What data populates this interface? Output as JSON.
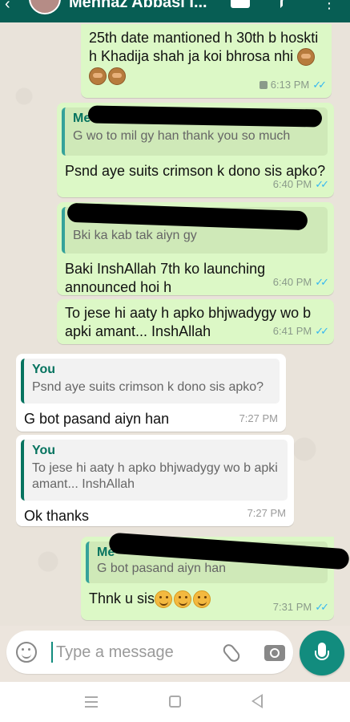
{
  "header": {
    "contact_name": "Mehnaz Abbasi I..."
  },
  "messages": [
    {
      "direction": "outgoing",
      "text": "25th date mantioned h 30th b hoskti h Khadija shah ja koi bhrosa nhi",
      "emojis": [
        "see-no-evil-monkey",
        "see-no-evil-monkey",
        "see-no-evil-monkey"
      ],
      "time": "6:13 PM",
      "voice_icon": true,
      "read": true
    },
    {
      "direction": "outgoing",
      "quote": {
        "author": "Me",
        "text": "G wo to mil gy han thank you so much",
        "author_redacted": true
      },
      "text": "Psnd aye suits crimson k dono sis apko?",
      "time": "6:40 PM",
      "read": true
    },
    {
      "direction": "outgoing",
      "quote": {
        "author": "",
        "text": "Bki ka kab tak aiyn gy",
        "author_redacted": true
      },
      "text": "Baki InshAllah 7th ko launching announced hoi h",
      "time": "6:40 PM",
      "read": true
    },
    {
      "direction": "outgoing",
      "text": "To jese hi aaty h apko bhjwadygy wo b apki amant... InshAllah",
      "time": "6:41 PM",
      "read": true
    },
    {
      "direction": "incoming",
      "quote": {
        "author": "You",
        "text": "Psnd aye suits crimson k dono sis apko?"
      },
      "text": "G bot pasand aiyn han",
      "time": "7:27 PM"
    },
    {
      "direction": "incoming",
      "quote": {
        "author": "You",
        "text": "To jese hi aaty h apko bhjwadygy wo b apki amant... InshAllah"
      },
      "text": "Ok thanks",
      "time": "7:27 PM"
    },
    {
      "direction": "outgoing",
      "quote": {
        "author": "Me",
        "text": "G bot pasand aiyn han",
        "author_redacted": true
      },
      "text": "Thnk u sis",
      "emojis": [
        "smiling-face",
        "smiling-face",
        "smiling-face"
      ],
      "time": "7:31 PM",
      "read": true
    }
  ],
  "composer": {
    "placeholder": "Type a message"
  },
  "colors": {
    "outgoing_bubble": "#dcf8c6",
    "incoming_bubble": "#ffffff",
    "read_ticks": "#34b7f1",
    "accent": "#128c7e"
  }
}
